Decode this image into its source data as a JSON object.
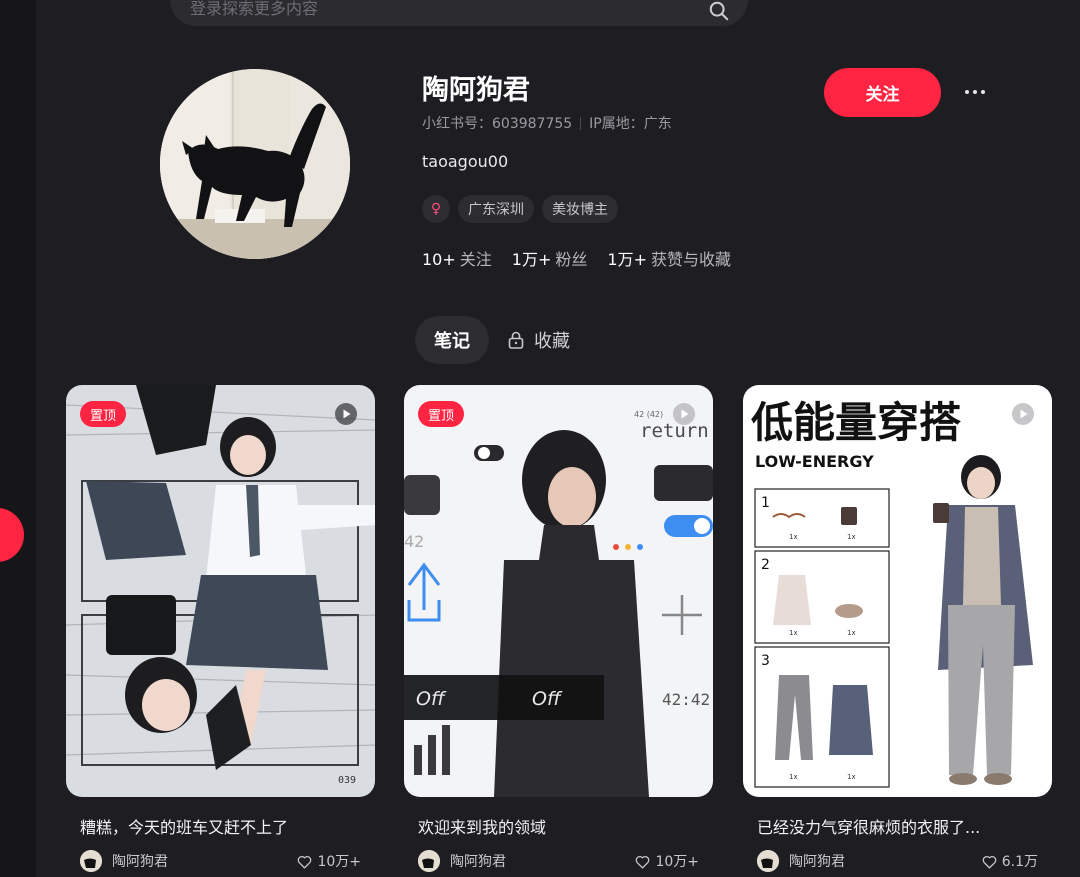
{
  "search": {
    "placeholder": "登录探索更多内容"
  },
  "profile": {
    "name": "陶阿狗君",
    "id_label": "小红书号：603987755",
    "ip_label": "IP属地：广东",
    "bio": "taoagou00",
    "gender_symbol": "♀",
    "tags": [
      "广东深圳",
      "美妆博主"
    ],
    "stats": [
      {
        "num": "10+",
        "label": "关注"
      },
      {
        "num": "1万+",
        "label": "粉丝"
      },
      {
        "num": "1万+",
        "label": "获赞与收藏"
      }
    ],
    "follow_label": "关注"
  },
  "tabs": [
    {
      "label": "笔记",
      "active": true
    },
    {
      "label": "收藏",
      "active": false,
      "icon": "lock-icon"
    }
  ],
  "notes": [
    {
      "badge": "置顶",
      "title": "糟糕，今天的班车又赶不上了",
      "author": "陶阿狗君",
      "likes": "10万+",
      "page_mark": "039"
    },
    {
      "badge": "置顶",
      "title": "欢迎来到我的领域",
      "author": "陶阿狗君",
      "likes": "10万+",
      "overlay": {
        "word_return": "return",
        "num_small": "42 (42)",
        "num_42": "42",
        "off_left": "Off",
        "off_right": "Off",
        "time": "42:42"
      }
    },
    {
      "badge": "",
      "title": "已经没力气穿很麻烦的衣服了...",
      "author": "陶阿狗君",
      "likes": "6.1万",
      "overlay": {
        "headline": "低能量穿搭",
        "subhead": "LOW-ENERGY",
        "rows": [
          {
            "n": "1",
            "qty_a": "1x",
            "qty_b": "1x"
          },
          {
            "n": "2",
            "qty_a": "1x",
            "qty_b": "1x"
          },
          {
            "n": "3",
            "qty_a": "1x",
            "qty_b": "1x"
          }
        ]
      }
    }
  ],
  "colors": {
    "accent": "#ff2442",
    "background": "#1e1e22"
  }
}
